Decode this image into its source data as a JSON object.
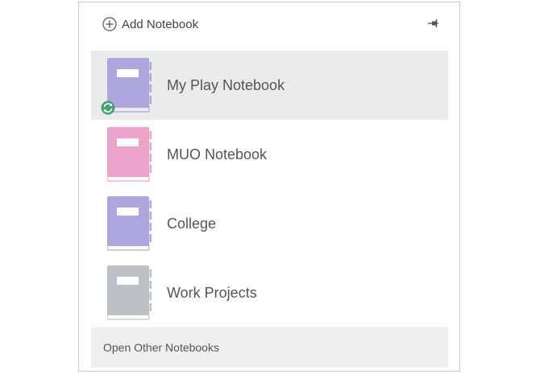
{
  "header": {
    "add_label": "Add Notebook",
    "add_icon": "plus-circle-icon",
    "pin_icon": "pin-icon"
  },
  "notebooks": [
    {
      "name": "My Play Notebook",
      "color": "#aea6de",
      "selected": true,
      "syncing": true
    },
    {
      "name": "MUO Notebook",
      "color": "#eda2c9",
      "selected": false,
      "syncing": false
    },
    {
      "name": "College",
      "color": "#aea6de",
      "selected": false,
      "syncing": false
    },
    {
      "name": "Work Projects",
      "color": "#bdc1c6",
      "selected": false,
      "syncing": false
    }
  ],
  "sync_badge": {
    "icon": "sync-icon",
    "color": "#3fa36e"
  },
  "footer": {
    "open_other_label": "Open Other Notebooks"
  }
}
